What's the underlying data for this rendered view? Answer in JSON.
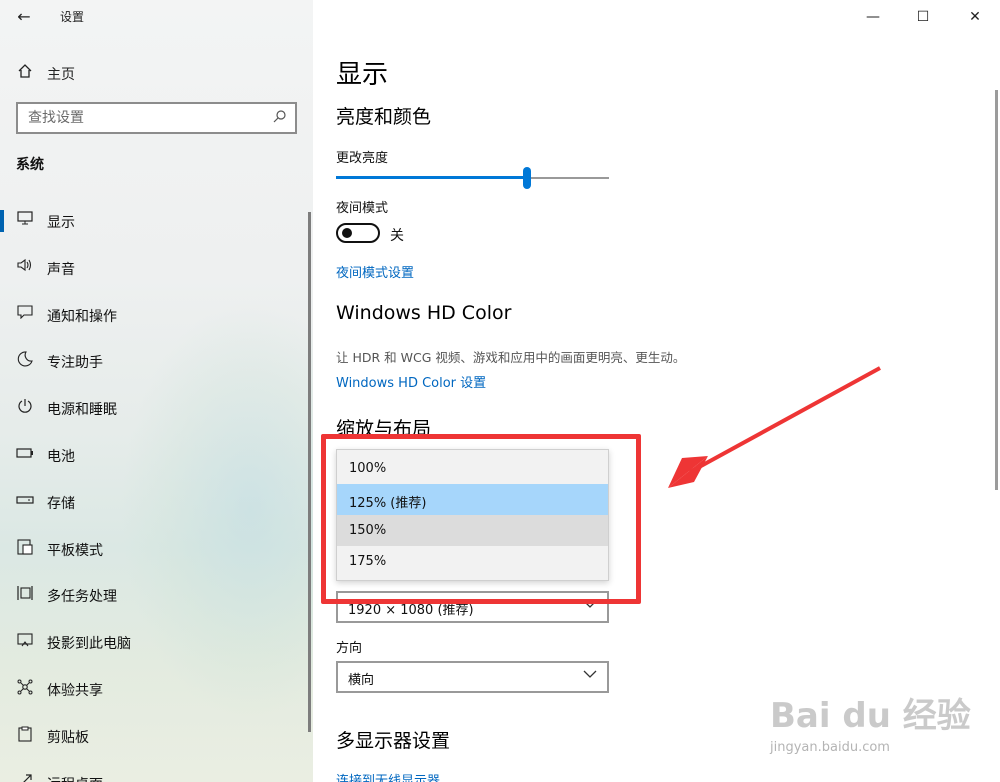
{
  "app": {
    "title": "设置",
    "back_glyph": "←",
    "window_controls": {
      "minimize": "—",
      "maximize": "☐",
      "close": "✕"
    }
  },
  "sidebar": {
    "home_label": "主页",
    "search_placeholder": "查找设置",
    "section_title": "系统",
    "items": [
      {
        "label": "显示",
        "icon": "monitor-icon",
        "glyph": "▭",
        "selected": true
      },
      {
        "label": "声音",
        "icon": "speaker-icon",
        "glyph": "🔈"
      },
      {
        "label": "通知和操作",
        "icon": "notification-icon",
        "glyph": "▢"
      },
      {
        "label": "专注助手",
        "icon": "moon-icon",
        "glyph": "☾"
      },
      {
        "label": "电源和睡眠",
        "icon": "power-icon",
        "glyph": "⏻"
      },
      {
        "label": "电池",
        "icon": "battery-icon",
        "glyph": "▭"
      },
      {
        "label": "存储",
        "icon": "storage-icon",
        "glyph": "▬"
      },
      {
        "label": "平板模式",
        "icon": "tablet-mode-icon",
        "glyph": "▣"
      },
      {
        "label": "多任务处理",
        "icon": "multitask-icon",
        "glyph": "⧉"
      },
      {
        "label": "投影到此电脑",
        "icon": "project-icon",
        "glyph": "▱"
      },
      {
        "label": "体验共享",
        "icon": "share-icon",
        "glyph": "✲"
      },
      {
        "label": "剪贴板",
        "icon": "clipboard-icon",
        "glyph": "▤"
      },
      {
        "label": "远程桌面",
        "icon": "remote-desktop-icon",
        "glyph": "⤢"
      }
    ]
  },
  "main": {
    "page_title": "显示",
    "brightness": {
      "heading": "亮度和颜色",
      "slider_label": "更改亮度",
      "value_percent": 70
    },
    "night_light": {
      "label": "夜间模式",
      "state": "关",
      "settings_link": "夜间模式设置"
    },
    "hd_color": {
      "heading": "Windows HD Color",
      "description": "让 HDR 和 WCG 视频、游戏和应用中的画面更明亮、更生动。",
      "link": "Windows HD Color 设置"
    },
    "scale_layout": {
      "heading": "缩放与布局",
      "scale_options": [
        "100%",
        "125% (推荐)",
        "150%",
        "175%"
      ],
      "selected_option": "125% (推荐)",
      "hovered_option": "150%",
      "resolution_value": "1920 × 1080 (推荐)",
      "orientation_label": "方向",
      "orientation_value": "横向"
    },
    "multi_display": {
      "heading": "多显示器设置",
      "link": "连接到无线显示器"
    }
  },
  "annotation": {
    "color": "#ee3535"
  },
  "watermark": {
    "brand": "Bai du 经验",
    "url": "jingyan.baidu.com"
  },
  "colors": {
    "accent": "#0078d7",
    "link": "#0067c0",
    "selection": "#a6d6fb"
  }
}
